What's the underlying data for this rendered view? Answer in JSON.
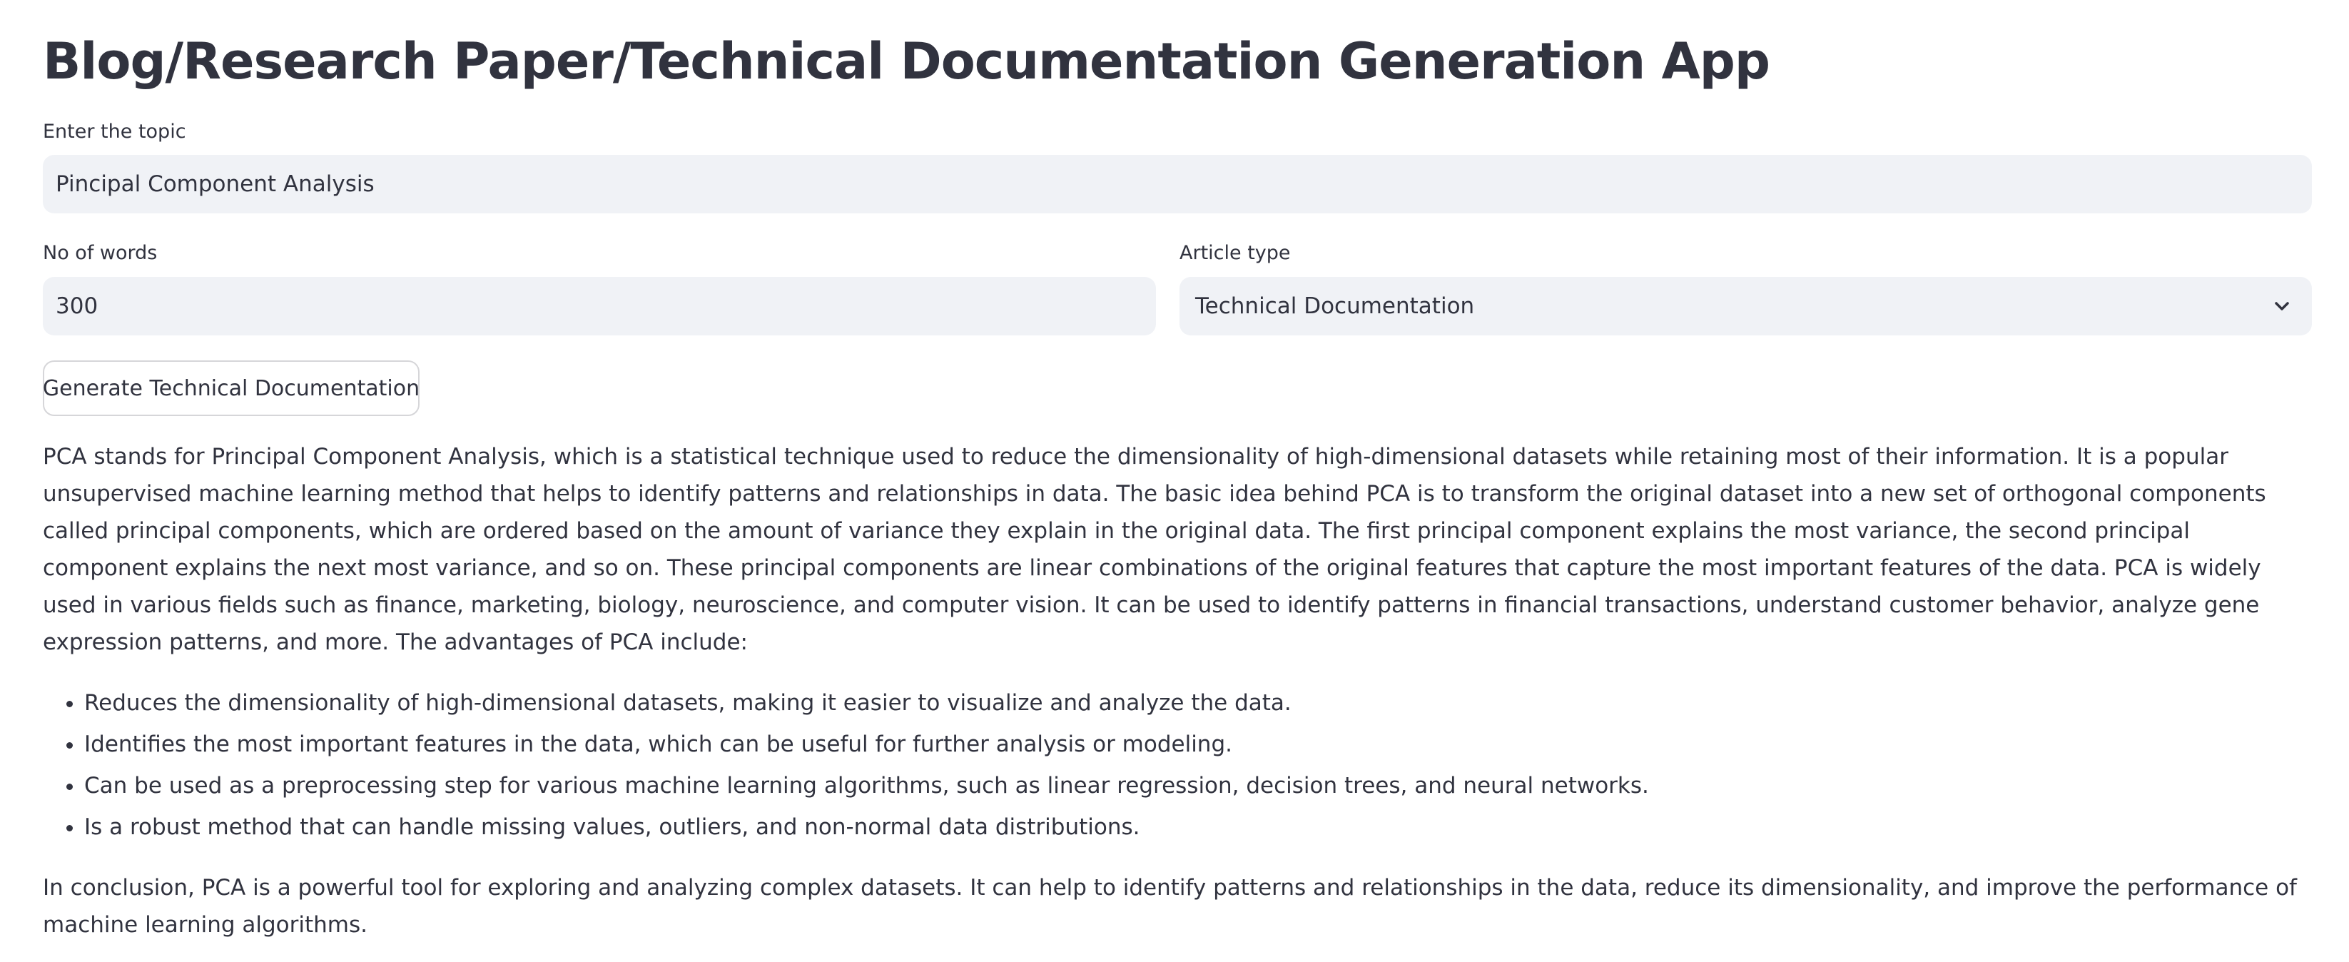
{
  "app": {
    "title": "Blog/Research Paper/Technical Documentation Generation App"
  },
  "form": {
    "topic_label": "Enter the topic",
    "topic_value": "Pincipal Component Analysis",
    "words_label": "No of words",
    "words_value": "300",
    "article_type_label": "Article type",
    "article_type_value": "Technical Documentation",
    "generate_button_label": "Generate Technical Documentation"
  },
  "output": {
    "intro": "PCA stands for Principal Component Analysis, which is a statistical technique used to reduce the dimensionality of high-dimensional datasets while retaining most of their information. It is a popular unsupervised machine learning method that helps to identify patterns and relationships in data. The basic idea behind PCA is to transform the original dataset into a new set of orthogonal components called principal components, which are ordered based on the amount of variance they explain in the original data. The first principal component explains the most variance, the second principal component explains the next most variance, and so on. These principal components are linear combinations of the original features that capture the most important features of the data. PCA is widely used in various fields such as finance, marketing, biology, neuroscience, and computer vision. It can be used to identify patterns in financial transactions, understand customer behavior, analyze gene expression patterns, and more. The advantages of PCA include:",
    "advantages": [
      "Reduces the dimensionality of high-dimensional datasets, making it easier to visualize and analyze the data.",
      "Identifies the most important features in the data, which can be useful for further analysis or modeling.",
      "Can be used as a preprocessing step for various machine learning algorithms, such as linear regression, decision trees, and neural networks.",
      "Is a robust method that can handle missing values, outliers, and non-normal data distributions."
    ],
    "conclusion": "In conclusion, PCA is a powerful tool for exploring and analyzing complex datasets. It can help to identify patterns and relationships in the data, reduce its dimensionality, and improve the performance of machine learning algorithms."
  }
}
